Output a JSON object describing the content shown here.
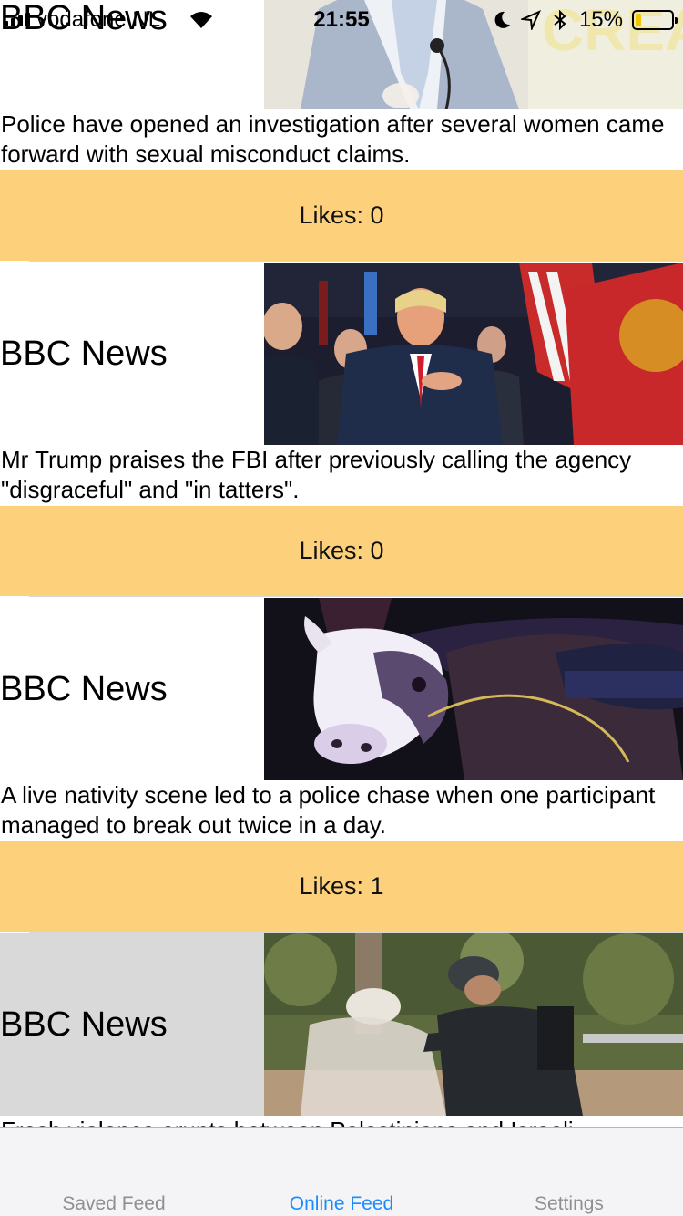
{
  "status_bar": {
    "carrier": "vodafone NL",
    "time": "21:55",
    "battery": "15%",
    "battery_level": 0.15
  },
  "feed": {
    "items": [
      {
        "source": "BBC News",
        "description": "Police have opened an investigation after several women came forward with sexual misconduct claims.",
        "likes": "Likes: 0"
      },
      {
        "source": "BBC News",
        "description": "Mr Trump praises the FBI after previously calling the agency \"disgraceful\" and \"in tatters\".",
        "likes": "Likes: 0"
      },
      {
        "source": "BBC News",
        "description": "A live nativity scene led to a police chase when one participant managed to break out twice in a day.",
        "likes": "Likes: 1"
      },
      {
        "source": "BBC News",
        "description": "Fresh violence erupts between Palestinians and Israeli"
      }
    ]
  },
  "tab_bar": {
    "tabs": [
      {
        "label": "Saved Feed",
        "active": false
      },
      {
        "label": "Online Feed",
        "active": true
      },
      {
        "label": "Settings",
        "active": false
      }
    ]
  },
  "colors": {
    "likes_background": "#fdd07c",
    "active_tab": "#1a8cff",
    "inactive_tab": "#8e8e93",
    "selected_row": "#d9d9d9"
  }
}
